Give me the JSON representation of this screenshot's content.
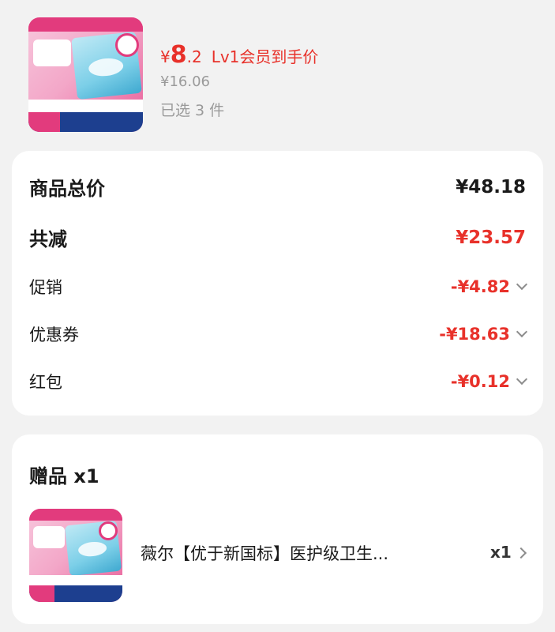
{
  "product": {
    "price_currency": "¥",
    "price_integer": "8",
    "price_decimal": ".2",
    "price_note": "Lv1会员到手价",
    "original_price": "¥16.06",
    "selected_count": "已选 3 件",
    "image_icon": "sanitary-pad-product-image"
  },
  "summary": {
    "total_label": "商品总价",
    "total_value": "¥48.18",
    "discount_label": "共减",
    "discount_value": "¥23.57",
    "items": [
      {
        "label": "促销",
        "value": "-¥4.82"
      },
      {
        "label": "优惠券",
        "value": "-¥18.63"
      },
      {
        "label": "红包",
        "value": "-¥0.12"
      }
    ]
  },
  "gift": {
    "title": "赠品 x1",
    "name": "薇尔【优于新国标】医护级卫生...",
    "quantity": "x1"
  },
  "colors": {
    "accent_red": "#e8312a",
    "text_gray": "#9a9a9a",
    "background": "#f2f2f2"
  }
}
